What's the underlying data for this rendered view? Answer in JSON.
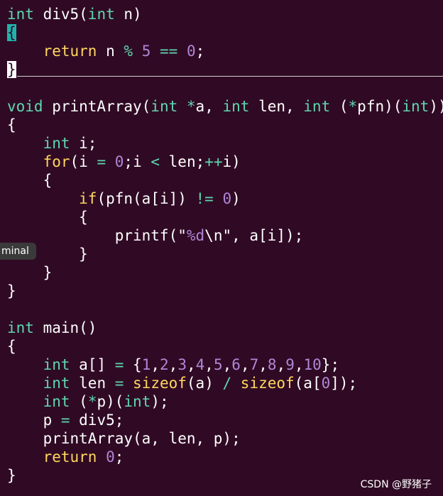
{
  "theme": {
    "background": "#300a24",
    "type_color": "#5fd7af",
    "keyword_color": "#ffd75f",
    "number_color": "#af87d7",
    "cursor_color": "#20b2aa"
  },
  "code_lines": [
    [
      {
        "t": "type",
        "v": "int"
      },
      {
        "t": "txt",
        "v": " div5("
      },
      {
        "t": "type",
        "v": "int"
      },
      {
        "t": "txt",
        "v": " n)"
      }
    ],
    [
      {
        "t": "cursor",
        "v": "{"
      }
    ],
    [
      {
        "t": "txt",
        "v": "    "
      },
      {
        "t": "kw",
        "v": "return"
      },
      {
        "t": "txt",
        "v": " n "
      },
      {
        "t": "op",
        "v": "%"
      },
      {
        "t": "txt",
        "v": " "
      },
      {
        "t": "num",
        "v": "5"
      },
      {
        "t": "txt",
        "v": " "
      },
      {
        "t": "op",
        "v": "=="
      },
      {
        "t": "txt",
        "v": " "
      },
      {
        "t": "num",
        "v": "0"
      },
      {
        "t": "txt",
        "v": ";"
      }
    ],
    [
      {
        "t": "cursor_hl",
        "v": "}"
      }
    ],
    [],
    [
      {
        "t": "type",
        "v": "void"
      },
      {
        "t": "txt",
        "v": " printArray("
      },
      {
        "t": "type",
        "v": "int"
      },
      {
        "t": "txt",
        "v": " "
      },
      {
        "t": "op",
        "v": "*"
      },
      {
        "t": "txt",
        "v": "a, "
      },
      {
        "t": "type",
        "v": "int"
      },
      {
        "t": "txt",
        "v": " len, "
      },
      {
        "t": "type",
        "v": "int"
      },
      {
        "t": "txt",
        "v": " ("
      },
      {
        "t": "op",
        "v": "*"
      },
      {
        "t": "txt",
        "v": "pfn)("
      },
      {
        "t": "type",
        "v": "int"
      },
      {
        "t": "txt",
        "v": "))"
      }
    ],
    [
      {
        "t": "txt",
        "v": "{"
      }
    ],
    [
      {
        "t": "txt",
        "v": "    "
      },
      {
        "t": "type",
        "v": "int"
      },
      {
        "t": "txt",
        "v": " i;"
      }
    ],
    [
      {
        "t": "txt",
        "v": "    "
      },
      {
        "t": "kw",
        "v": "for"
      },
      {
        "t": "txt",
        "v": "(i "
      },
      {
        "t": "op",
        "v": "="
      },
      {
        "t": "txt",
        "v": " "
      },
      {
        "t": "num",
        "v": "0"
      },
      {
        "t": "txt",
        "v": ";i "
      },
      {
        "t": "op",
        "v": "<"
      },
      {
        "t": "txt",
        "v": " len;"
      },
      {
        "t": "op",
        "v": "++"
      },
      {
        "t": "txt",
        "v": "i)"
      }
    ],
    [
      {
        "t": "txt",
        "v": "    {"
      }
    ],
    [
      {
        "t": "txt",
        "v": "        "
      },
      {
        "t": "kw",
        "v": "if"
      },
      {
        "t": "txt",
        "v": "(pfn(a[i]) "
      },
      {
        "t": "op",
        "v": "!="
      },
      {
        "t": "txt",
        "v": " "
      },
      {
        "t": "num",
        "v": "0"
      },
      {
        "t": "txt",
        "v": ")"
      }
    ],
    [
      {
        "t": "txt",
        "v": "        {"
      }
    ],
    [
      {
        "t": "txt",
        "v": "            printf(\""
      },
      {
        "t": "str",
        "v": "%d"
      },
      {
        "t": "esc",
        "v": "\\n"
      },
      {
        "t": "txt",
        "v": "\", a[i]);"
      }
    ],
    [
      {
        "t": "txt",
        "v": "        }"
      }
    ],
    [
      {
        "t": "txt",
        "v": "    }"
      }
    ],
    [
      {
        "t": "txt",
        "v": "}"
      }
    ],
    [],
    [
      {
        "t": "type",
        "v": "int"
      },
      {
        "t": "txt",
        "v": " main()"
      }
    ],
    [
      {
        "t": "txt",
        "v": "{"
      }
    ],
    [
      {
        "t": "txt",
        "v": "    "
      },
      {
        "t": "type",
        "v": "int"
      },
      {
        "t": "txt",
        "v": " a[] "
      },
      {
        "t": "op",
        "v": "="
      },
      {
        "t": "txt",
        "v": " {"
      },
      {
        "t": "num",
        "v": "1"
      },
      {
        "t": "txt",
        "v": ","
      },
      {
        "t": "num",
        "v": "2"
      },
      {
        "t": "txt",
        "v": ","
      },
      {
        "t": "num",
        "v": "3"
      },
      {
        "t": "txt",
        "v": ","
      },
      {
        "t": "num",
        "v": "4"
      },
      {
        "t": "txt",
        "v": ","
      },
      {
        "t": "num",
        "v": "5"
      },
      {
        "t": "txt",
        "v": ","
      },
      {
        "t": "num",
        "v": "6"
      },
      {
        "t": "txt",
        "v": ","
      },
      {
        "t": "num",
        "v": "7"
      },
      {
        "t": "txt",
        "v": ","
      },
      {
        "t": "num",
        "v": "8"
      },
      {
        "t": "txt",
        "v": ","
      },
      {
        "t": "num",
        "v": "9"
      },
      {
        "t": "txt",
        "v": ","
      },
      {
        "t": "num",
        "v": "10"
      },
      {
        "t": "txt",
        "v": "};"
      }
    ],
    [
      {
        "t": "txt",
        "v": "    "
      },
      {
        "t": "type",
        "v": "int"
      },
      {
        "t": "txt",
        "v": " len "
      },
      {
        "t": "op",
        "v": "="
      },
      {
        "t": "txt",
        "v": " "
      },
      {
        "t": "kw",
        "v": "sizeof"
      },
      {
        "t": "txt",
        "v": "(a) "
      },
      {
        "t": "op",
        "v": "/"
      },
      {
        "t": "txt",
        "v": " "
      },
      {
        "t": "kw",
        "v": "sizeof"
      },
      {
        "t": "txt",
        "v": "(a["
      },
      {
        "t": "num",
        "v": "0"
      },
      {
        "t": "txt",
        "v": "]);"
      }
    ],
    [
      {
        "t": "txt",
        "v": "    "
      },
      {
        "t": "type",
        "v": "int"
      },
      {
        "t": "txt",
        "v": " ("
      },
      {
        "t": "op",
        "v": "*"
      },
      {
        "t": "txt",
        "v": "p)("
      },
      {
        "t": "type",
        "v": "int"
      },
      {
        "t": "txt",
        "v": ");"
      }
    ],
    [
      {
        "t": "txt",
        "v": "    p "
      },
      {
        "t": "op",
        "v": "="
      },
      {
        "t": "txt",
        "v": " div5;"
      }
    ],
    [
      {
        "t": "txt",
        "v": "    printArray(a, len, p);"
      }
    ],
    [
      {
        "t": "txt",
        "v": "    "
      },
      {
        "t": "kw",
        "v": "return"
      },
      {
        "t": "txt",
        "v": " "
      },
      {
        "t": "num",
        "v": "0"
      },
      {
        "t": "txt",
        "v": ";"
      }
    ],
    [
      {
        "t": "txt",
        "v": "}"
      }
    ]
  ],
  "tooltip": {
    "text": "minal"
  },
  "watermark": {
    "text": "CSDN @野猪子"
  }
}
